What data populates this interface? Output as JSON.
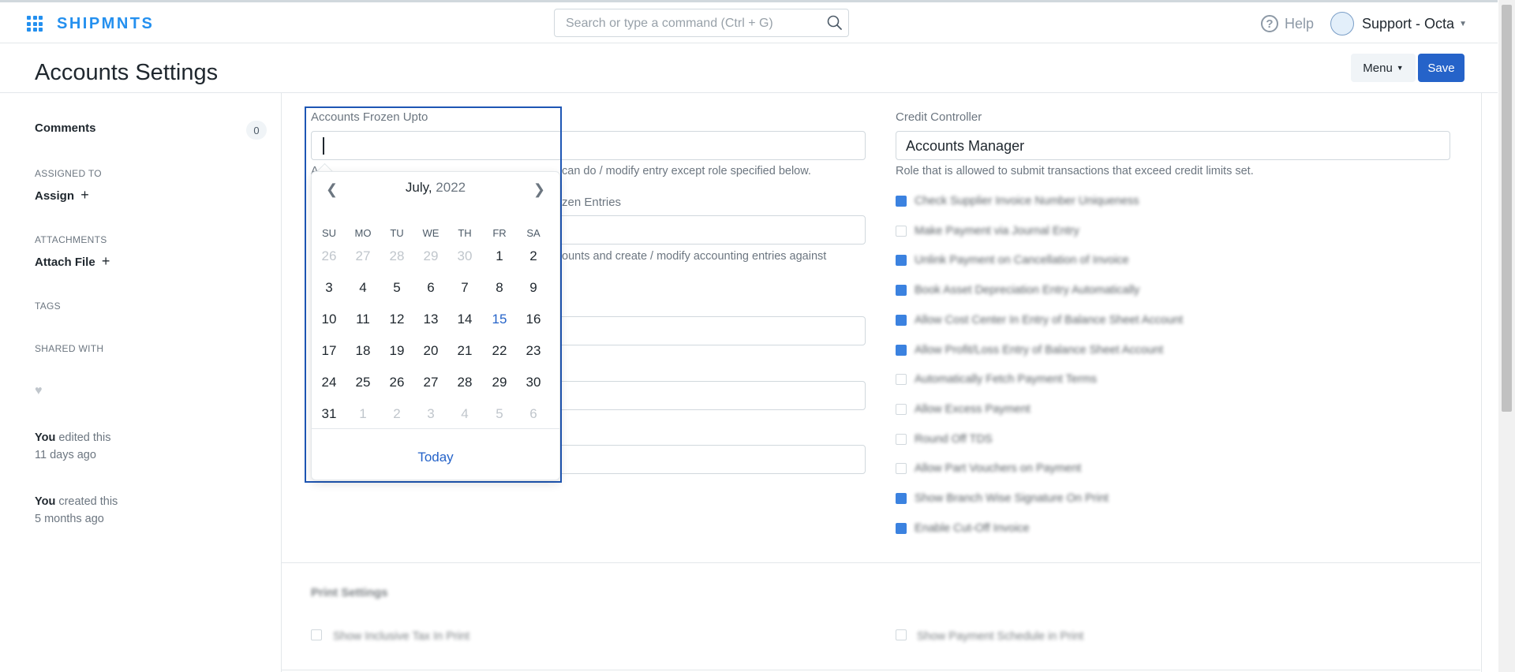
{
  "topbar": {
    "brand": "SHIPMNTS",
    "search_placeholder": "Search or type a command (Ctrl + G)",
    "help": "Help",
    "user": "Support - Octa"
  },
  "header": {
    "title": "Accounts Settings",
    "menu": "Menu",
    "save": "Save"
  },
  "sidebar": {
    "comments": "Comments",
    "comments_count": "0",
    "assigned_to": "ASSIGNED TO",
    "assign": "Assign",
    "attachments": "ATTACHMENTS",
    "attach_file": "Attach File",
    "tags": "TAGS",
    "shared_with": "SHARED WITH",
    "activity": [
      {
        "who": "You",
        "what": " edited this",
        "when": "11 days ago"
      },
      {
        "who": "You",
        "what": " created this",
        "when": "5 months ago"
      }
    ]
  },
  "form": {
    "frozen_label": "Accounts Frozen Upto",
    "frozen_value": "",
    "frozen_desc_left": "Ac",
    "frozen_desc_right": "can do / modify entry except role specified below.",
    "frozen_role_label_tail": "zen Entries",
    "frozen_role_desc_tail": "ounts and create / modify accounting entries against",
    "credit_label": "Credit Controller",
    "credit_value": "Accounts Manager",
    "credit_desc": "Role that is allowed to submit transactions that exceed credit limits set."
  },
  "calendar": {
    "month": "July,",
    "year": "2022",
    "weekdays": [
      "SU",
      "MO",
      "TU",
      "WE",
      "TH",
      "FR",
      "SA"
    ],
    "weeks": [
      [
        "26",
        "27",
        "28",
        "29",
        "30",
        "1",
        "2"
      ],
      [
        "3",
        "4",
        "5",
        "6",
        "7",
        "8",
        "9"
      ],
      [
        "10",
        "11",
        "12",
        "13",
        "14",
        "15",
        "16"
      ],
      [
        "17",
        "18",
        "19",
        "20",
        "21",
        "22",
        "23"
      ],
      [
        "24",
        "25",
        "26",
        "27",
        "28",
        "29",
        "30"
      ],
      [
        "31",
        "1",
        "2",
        "3",
        "4",
        "5",
        "6"
      ]
    ],
    "today_button": "Today"
  },
  "checkboxes": [
    {
      "label": "Check Supplier Invoice Number Uniqueness",
      "checked": true
    },
    {
      "label": "Make Payment via Journal Entry",
      "checked": false
    },
    {
      "label": "Unlink Payment on Cancellation of Invoice",
      "checked": true
    },
    {
      "label": "Book Asset Depreciation Entry Automatically",
      "checked": true
    },
    {
      "label": "Allow Cost Center In Entry of Balance Sheet Account",
      "checked": true
    },
    {
      "label": "Allow Profit/Loss Entry of Balance Sheet Account",
      "checked": true
    },
    {
      "label": "Automatically Fetch Payment Terms",
      "checked": false
    },
    {
      "label": "Allow Excess Payment",
      "checked": false
    },
    {
      "label": "Round Off TDS",
      "checked": false
    },
    {
      "label": "Allow Part Vouchers on Payment",
      "checked": false
    },
    {
      "label": "Show Branch Wise Signature On Print",
      "checked": true
    },
    {
      "label": "Enable Cut-Off Invoice",
      "checked": true
    }
  ],
  "print_section": {
    "title": "Print Settings",
    "left_check": "Show Inclusive Tax In Print",
    "right_check": "Show Payment Schedule in Print"
  },
  "colors": {
    "brand": "#2490ef",
    "primary": "#2563c9",
    "focus_border": "#1e56b4"
  }
}
